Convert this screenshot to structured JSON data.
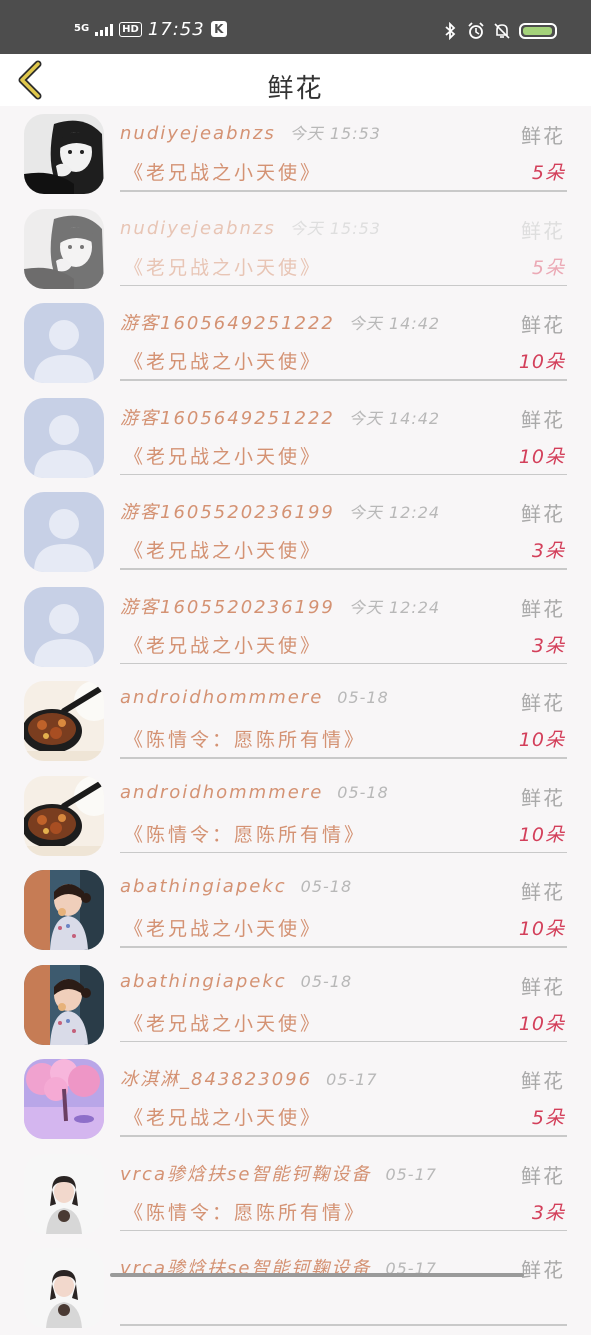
{
  "status_bar": {
    "network": "5G",
    "hd": "HD",
    "time": "17:53",
    "k_icon": "K",
    "icons": [
      "signal-icon",
      "bluetooth-icon",
      "alarm-icon",
      "mute-bell-icon",
      "battery-icon"
    ],
    "battery_level": 0.95
  },
  "header": {
    "title": "鲜花",
    "back_icon": "chevron-left-icon"
  },
  "colors": {
    "name": "#d49273",
    "count": "#d33f5a",
    "type": "#a9a9a9",
    "back": "#e0c84c"
  },
  "rows": [
    {
      "avatar": "girl-bw",
      "name": "nudiyejeabnzs",
      "time": "今天 15:53",
      "type": "鲜花",
      "book": "《老兄战之小天使》",
      "count": "5朵",
      "faded": false
    },
    {
      "avatar": "girl-bw",
      "name": "nudiyejeabnzs",
      "time": "今天 15:53",
      "type": "鲜花",
      "book": "《老兄战之小天使》",
      "count": "5朵",
      "faded": true
    },
    {
      "avatar": "default",
      "name": "游客1605649251222",
      "time": "今天 14:42",
      "type": "鲜花",
      "book": "《老兄战之小天使》",
      "count": "10朵",
      "faded": false
    },
    {
      "avatar": "default",
      "name": "游客1605649251222",
      "time": "今天 14:42",
      "type": "鲜花",
      "book": "《老兄战之小天使》",
      "count": "10朵",
      "faded": false
    },
    {
      "avatar": "default",
      "name": "游客1605520236199",
      "time": "今天 12:24",
      "type": "鲜花",
      "book": "《老兄战之小天使》",
      "count": "3朵",
      "faded": false
    },
    {
      "avatar": "default",
      "name": "游客1605520236199",
      "time": "今天 12:24",
      "type": "鲜花",
      "book": "《老兄战之小天使》",
      "count": "3朵",
      "faded": false
    },
    {
      "avatar": "food",
      "name": "androidhommmere",
      "time": "05-18",
      "type": "鲜花",
      "book": "《陈情令：愿陈所有情》",
      "count": "10朵",
      "faded": false
    },
    {
      "avatar": "food",
      "name": "androidhommmere",
      "time": "05-18",
      "type": "鲜花",
      "book": "《陈情令：愿陈所有情》",
      "count": "10朵",
      "faded": false
    },
    {
      "avatar": "girl-color",
      "name": "abathingiapekc",
      "time": "05-18",
      "type": "鲜花",
      "book": "《老兄战之小天使》",
      "count": "10朵",
      "faded": false
    },
    {
      "avatar": "girl-color",
      "name": "abathingiapekc",
      "time": "05-18",
      "type": "鲜花",
      "book": "《老兄战之小天使》",
      "count": "10朵",
      "faded": false
    },
    {
      "avatar": "blossom",
      "name": "冰淇淋_843823096",
      "time": "05-17",
      "type": "鲜花",
      "book": "《老兄战之小天使》",
      "count": "5朵",
      "faded": false
    },
    {
      "avatar": "girl-white",
      "name": "vrca骖焓扶se智能钶鞠设备",
      "time": "05-17",
      "type": "鲜花",
      "book": "《陈情令：愿陈所有情》",
      "count": "3朵",
      "faded": false
    },
    {
      "avatar": "girl-white",
      "name": "vrca骖焓扶se智能钶鞠设备",
      "time": "05-17",
      "type": "鲜花",
      "book": "",
      "count": "",
      "faded": false
    }
  ]
}
